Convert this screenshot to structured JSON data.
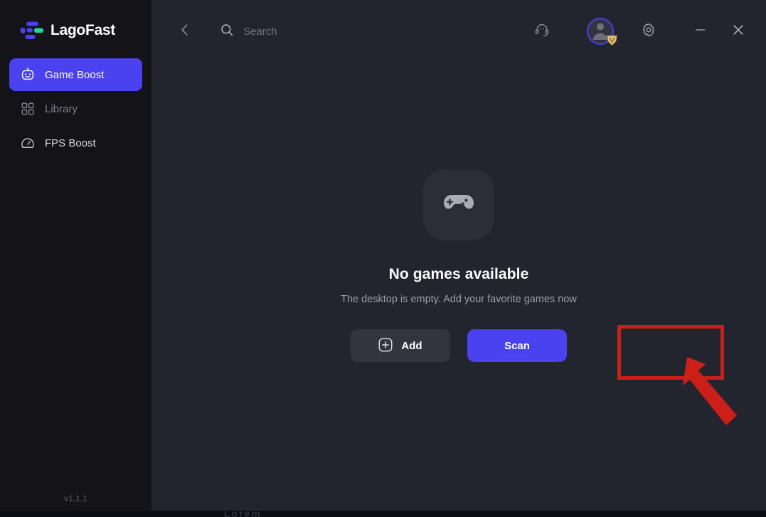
{
  "app": {
    "name": "LagoFast",
    "version": "v1.1.1",
    "accent_color": "#4a41f0",
    "sidebar_bg": "#141418",
    "main_bg": "#22252e",
    "annotation_color": "#cc1f17"
  },
  "sidebar": {
    "logo_label": "LagoFast",
    "logo_icon": "lagofast-logo-icon",
    "items": [
      {
        "label": "Game Boost",
        "icon": "game-boost-icon",
        "active": true
      },
      {
        "label": "Library",
        "icon": "library-grid-icon",
        "active": false
      },
      {
        "label": "FPS Boost",
        "icon": "fps-gauge-icon",
        "active": false
      }
    ],
    "version_label": "v1.1.1"
  },
  "topbar": {
    "back_icon": "chevron-left-icon",
    "search_icon": "search-icon",
    "search_value": "",
    "search_placeholder": "Search",
    "support_icon": "headset-support-icon",
    "avatar_icon": "user-avatar-icon",
    "avatar_badge_icon": "vip-crown-badge-icon",
    "settings_icon": "gear-icon",
    "minimize_icon": "minimize-icon",
    "close_icon": "close-icon"
  },
  "main": {
    "empty_state": {
      "illustration_icon": "gamepad-icon",
      "title": "No games available",
      "subtitle": "The desktop is empty. Add your favorite games now",
      "add_button_label": "Add",
      "add_button_icon": "plus-square-icon",
      "scan_button_label": "Scan"
    }
  },
  "annotation": {
    "highlight_target": "scan-button",
    "arrow_icon": "pointer-arrow-icon"
  },
  "taskbar": {
    "cut_off_text": "Lorem"
  }
}
